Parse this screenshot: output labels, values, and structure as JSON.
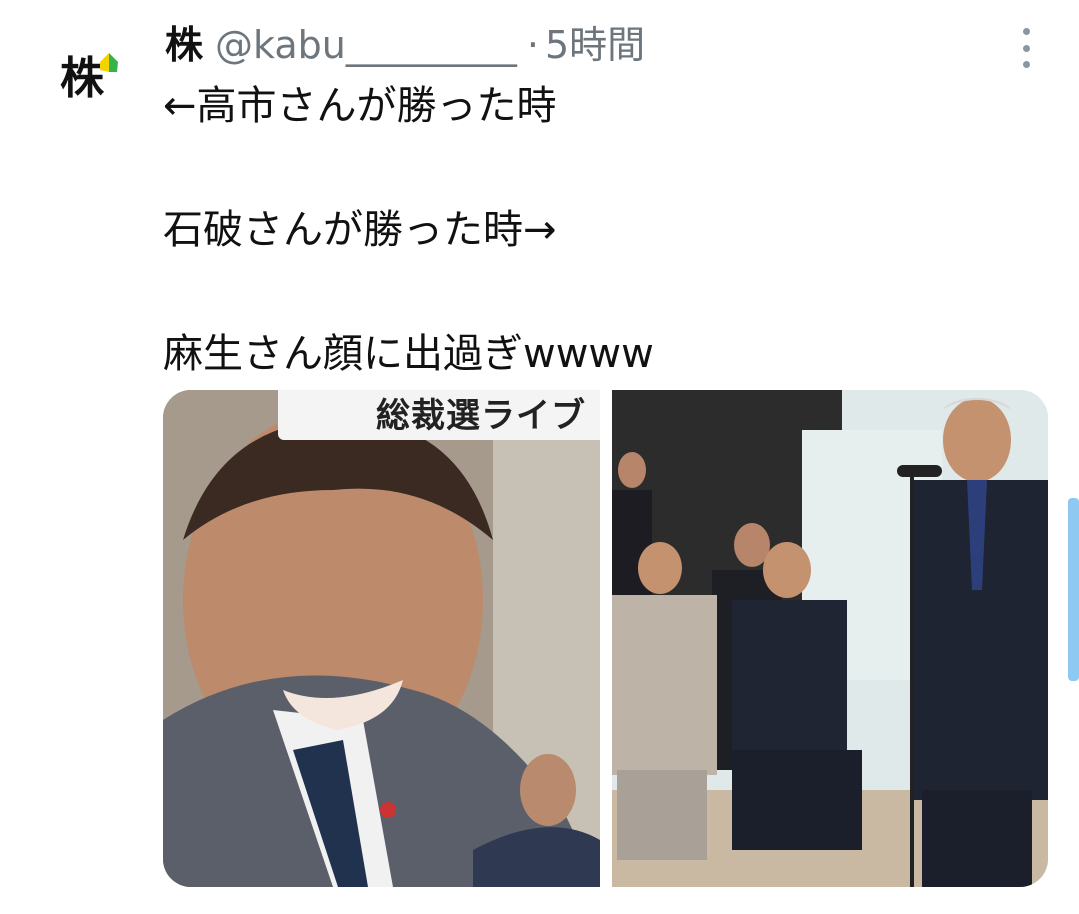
{
  "tweet": {
    "avatar_text": "株",
    "name": "株",
    "handle": "@kabu_________",
    "separator": "·",
    "time": "5時間",
    "text": "←高市さんが勝った時\n\n石破さんが勝った時→\n\n麻生さん顔に出過ぎwwww"
  },
  "media": {
    "left_caption": "総裁選ライブ"
  },
  "colors": {
    "secondary_text": "#6e767d",
    "scroll_indicator": "#8ec9f2"
  },
  "icons": {
    "more": "more-vertical-icon",
    "avatar_badge": "beginner-leaf-icon"
  }
}
